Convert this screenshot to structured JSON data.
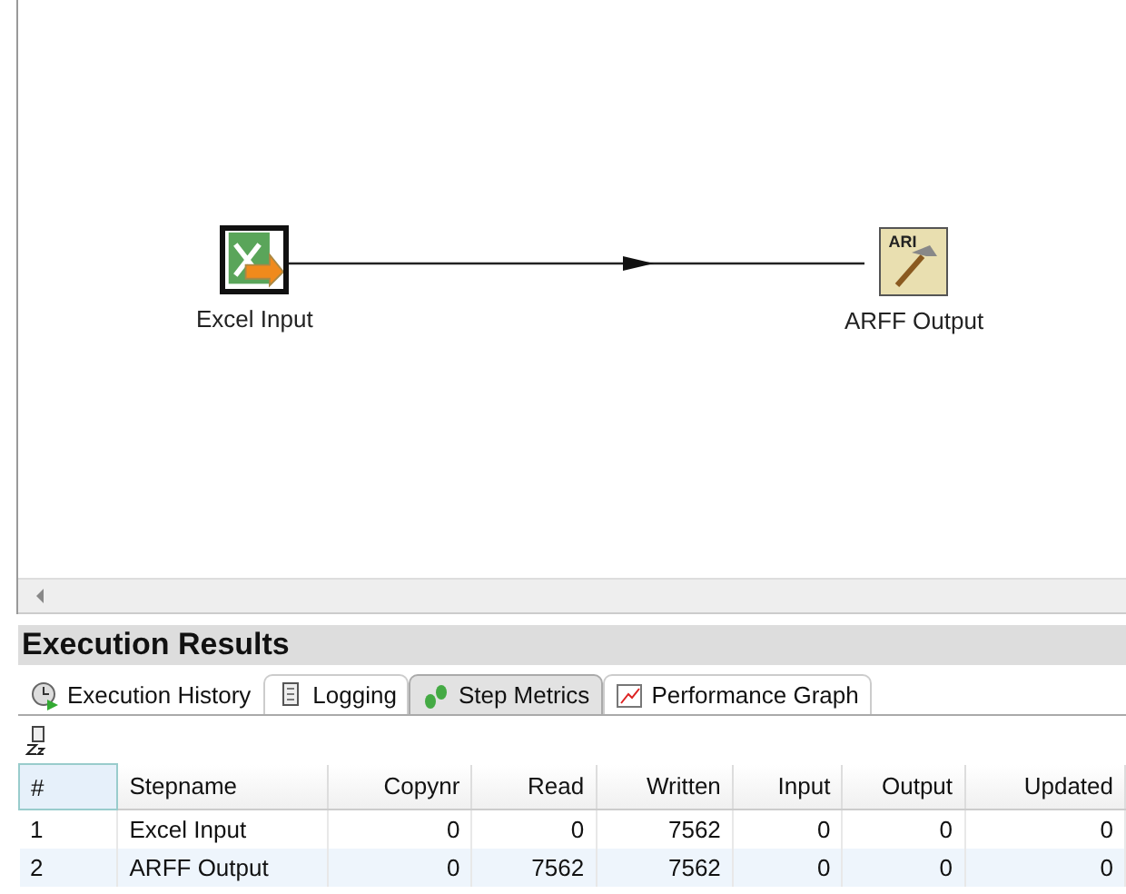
{
  "canvas": {
    "nodes": [
      {
        "label": "Excel Input",
        "kind": "excel",
        "selected": true
      },
      {
        "label": "ARFF Output",
        "kind": "arff",
        "icon_text": "ARI",
        "selected": false
      }
    ]
  },
  "results": {
    "title": "Execution Results",
    "tabs": [
      {
        "label": "Execution History",
        "kind": "history",
        "selected": false
      },
      {
        "label": "Logging",
        "kind": "logging",
        "selected": false
      },
      {
        "label": "Step Metrics",
        "kind": "metrics",
        "selected": true
      },
      {
        "label": "Performance Graph",
        "kind": "graph",
        "selected": false
      }
    ],
    "table": {
      "columns": [
        "#",
        "Stepname",
        "Copynr",
        "Read",
        "Written",
        "Input",
        "Output",
        "Updated"
      ],
      "rows": [
        [
          "1",
          "Excel Input",
          "0",
          "0",
          "7562",
          "0",
          "0",
          "0"
        ],
        [
          "2",
          "ARFF Output",
          "0",
          "7562",
          "7562",
          "0",
          "0",
          "0"
        ]
      ]
    }
  }
}
